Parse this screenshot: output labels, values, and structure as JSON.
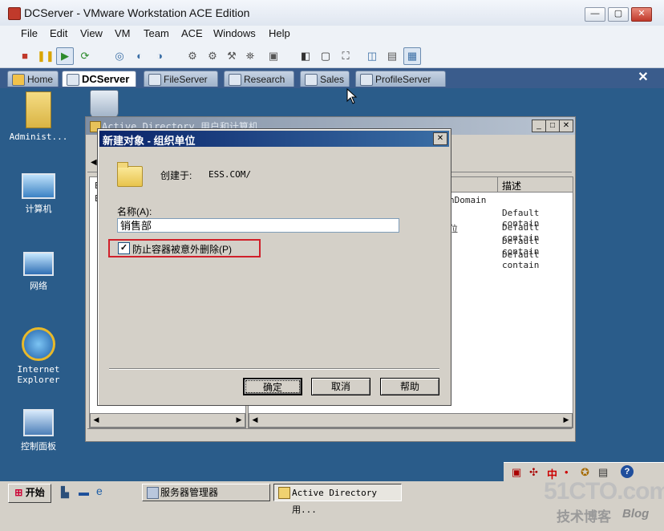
{
  "vm": {
    "title": "DCServer - VMware Workstation ACE Edition",
    "menu": [
      "File",
      "Edit",
      "View",
      "VM",
      "Team",
      "ACE",
      "Windows",
      "Help"
    ],
    "tabs": [
      {
        "label": "Home"
      },
      {
        "label": "DCServer"
      },
      {
        "label": "FileServer"
      },
      {
        "label": "Research"
      },
      {
        "label": "Sales"
      },
      {
        "label": "ProfileServer"
      }
    ],
    "window_buttons": {
      "minimize": "—",
      "maximize": "▢",
      "close": "✕"
    },
    "tabs_close": "✕"
  },
  "desktop": {
    "icons": [
      {
        "label": "Administ..."
      },
      {
        "label": "计算机"
      },
      {
        "label": "网络"
      },
      {
        "label": "Internet Explorer"
      },
      {
        "label": "控制面板"
      }
    ]
  },
  "ad_window": {
    "title": "Active Directory 用户和计算机",
    "column_header": "描述",
    "rows": [
      {
        "name": "nDomain",
        "desc": ""
      },
      {
        "name": "位",
        "desc": "Default contain"
      },
      {
        "name": "",
        "desc": "Default contain"
      },
      {
        "name": "",
        "desc": "Default contain"
      },
      {
        "name": "",
        "desc": "Default contain"
      }
    ],
    "left_items": [
      "E",
      "E"
    ]
  },
  "dialog": {
    "title": "新建对象 - 组织单位",
    "created_in_label": "创建于:",
    "created_in_value": "ESS.COM/",
    "name_label": "名称(A):",
    "name_value": "销售部",
    "protect_label": "防止容器被意外删除(P)",
    "protect_checked": true,
    "ok_label": "确定",
    "cancel_label": "取消",
    "help_label": "帮助"
  },
  "taskbar": {
    "start_label": "开始",
    "tasks": [
      {
        "label": "服务器管理器"
      },
      {
        "label": "Active Directory 用..."
      }
    ],
    "tray": [
      "中"
    ]
  },
  "watermark": {
    "line1": "51CTO.com",
    "line2": "技术博客",
    "line3": "Blog"
  }
}
